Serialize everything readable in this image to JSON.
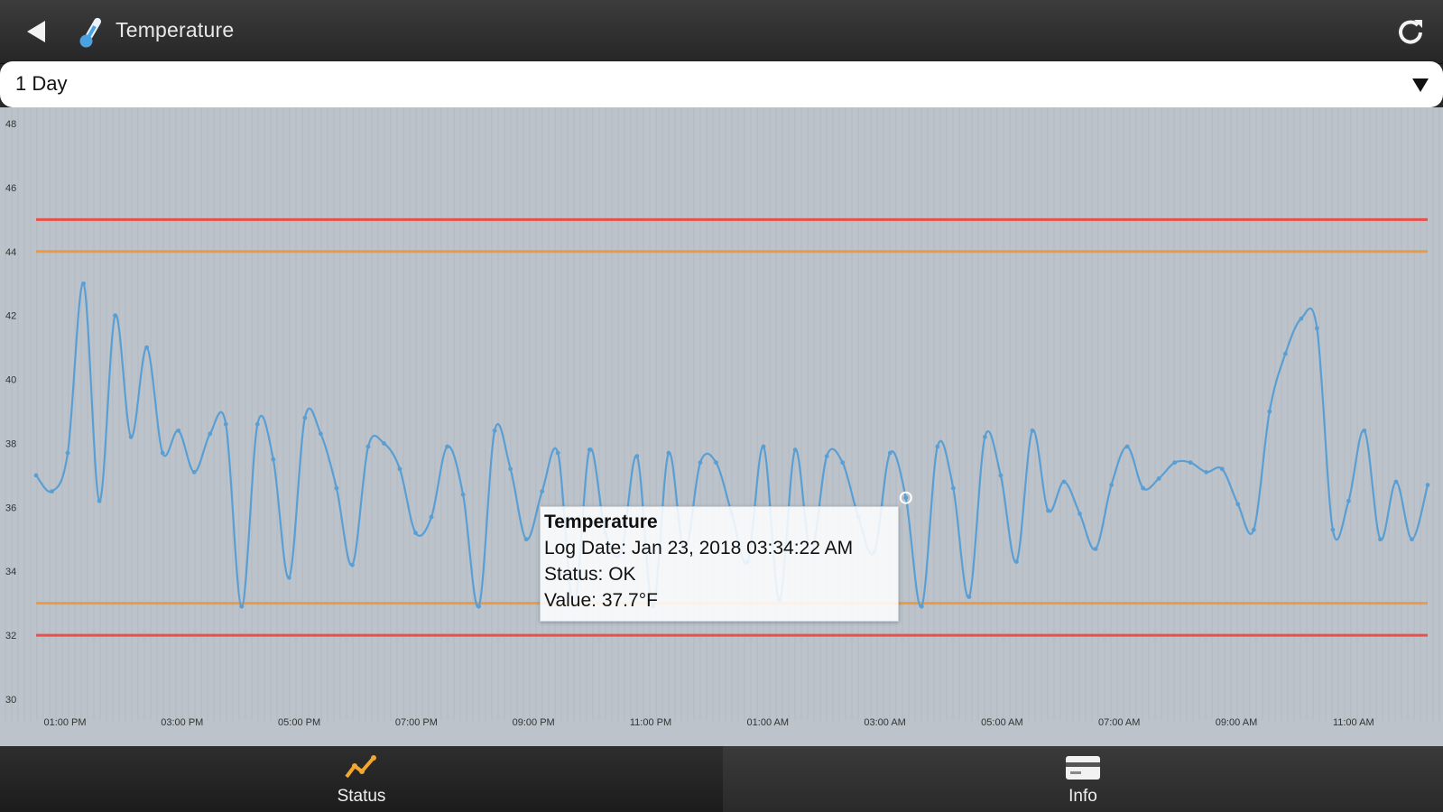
{
  "header": {
    "title": "Temperature",
    "back_icon": "back-arrow-icon",
    "sensor_icon": "thermometer-icon",
    "refresh_icon": "refresh-icon"
  },
  "range_select": {
    "selected": "1 Day",
    "caret_icon": "caret-down-icon"
  },
  "tooltip": {
    "title": "Temperature",
    "log_date": "Log Date: Jan 23, 2018 03:34:22 AM",
    "status": "Status: OK",
    "value": "Value: 37.7°F"
  },
  "tabs": [
    {
      "label": "Status",
      "icon": "trend-line-icon",
      "selected": true
    },
    {
      "label": "Info",
      "icon": "card-icon",
      "selected": false
    }
  ],
  "colors": {
    "line": "#5a9fd4",
    "alarm": "#e8504a",
    "warning": "#ec9a45",
    "plot_bg": "#bcc3ca",
    "tab_icon_accent": "#f0a830"
  },
  "chart_data": {
    "type": "line",
    "ylim": [
      30,
      48
    ],
    "y_ticks": [
      "30",
      "32",
      "34",
      "36",
      "38",
      "40",
      "42",
      "44",
      "46",
      "48"
    ],
    "x_ticks": [
      "01:00 PM",
      "03:00 PM",
      "05:00 PM",
      "07:00 PM",
      "09:00 PM",
      "11:00 PM",
      "01:00 AM",
      "03:00 AM",
      "05:00 AM",
      "07:00 AM",
      "09:00 AM",
      "11:00 AM"
    ],
    "thresholds": [
      {
        "kind": "alarm-high",
        "value": 45
      },
      {
        "kind": "warning-high",
        "value": 44
      },
      {
        "kind": "warning-low",
        "value": 33
      },
      {
        "kind": "alarm-low",
        "value": 32
      }
    ],
    "series": [
      {
        "values": [
          37.0,
          36.5,
          37.7,
          43.0,
          36.2,
          42.0,
          38.2,
          41.0,
          37.7,
          38.4,
          37.1,
          38.3,
          38.6,
          32.9,
          38.6,
          37.5,
          33.8,
          38.8,
          38.3,
          36.6,
          34.2,
          37.9,
          38.0,
          37.2,
          35.2,
          35.7,
          37.9,
          36.4,
          32.9,
          38.4,
          37.2,
          35.0,
          36.5,
          37.7,
          32.9,
          37.8,
          35.2,
          34.6,
          37.6,
          32.9,
          37.7,
          34.6,
          37.4,
          37.4,
          35.8,
          34.3,
          37.9,
          33.1,
          37.8,
          34.6,
          37.6,
          37.4,
          35.7,
          34.6,
          37.7,
          36.3,
          32.9,
          37.9,
          36.6,
          33.2,
          38.2,
          37.0,
          34.3,
          38.4,
          35.9,
          36.8,
          35.8,
          34.7,
          36.7,
          37.9,
          36.6,
          36.9,
          37.4,
          37.4,
          37.1,
          37.2,
          36.1,
          35.3,
          39.0,
          40.8,
          41.9,
          41.6,
          35.3,
          36.2,
          38.4,
          35.0,
          36.8,
          35.0,
          36.7
        ]
      }
    ]
  }
}
